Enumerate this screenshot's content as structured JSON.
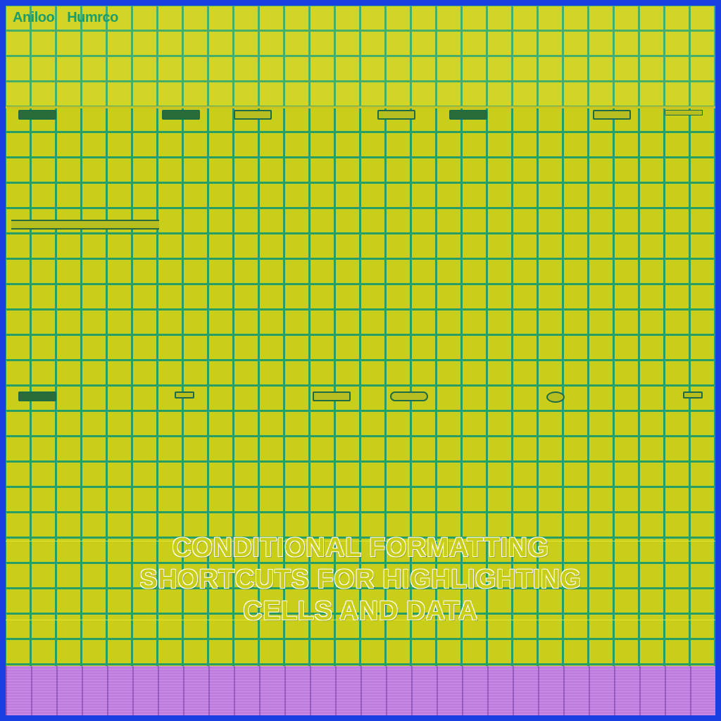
{
  "header": {
    "label1": "Aniloo",
    "label2": "Humrco"
  },
  "title": {
    "line1": "Conditional Formatting",
    "line2": "Shortcuts for Highlighting",
    "line3": "Cells and Data"
  },
  "colors": {
    "frame": "#1a3fe0",
    "cell": "#c9ce1a",
    "grid": "#1f9d68",
    "purple": "#c07de0"
  }
}
